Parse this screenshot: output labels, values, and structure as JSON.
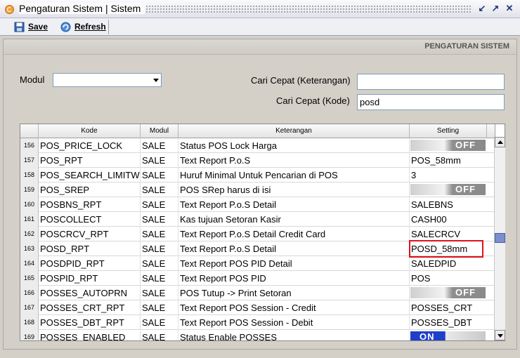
{
  "window": {
    "title": "Pengaturan Sistem | Sistem"
  },
  "toolbar": {
    "save_label": "Save",
    "refresh_label": "Refresh"
  },
  "header": {
    "title": "PENGATURAN SISTEM"
  },
  "filters": {
    "modul_label": "Modul",
    "modul_value": "",
    "cari_ket_label": "Cari Cepat (Keterangan)",
    "cari_ket_value": "",
    "cari_kode_label": "Cari Cepat (Kode)",
    "cari_kode_value": "posd"
  },
  "grid": {
    "columns": [
      "Kode",
      "Modul",
      "Keterangan",
      "Setting"
    ],
    "rows": [
      {
        "num": "156",
        "kode": "POS_PRICE_LOCK",
        "modul": "SALE",
        "ket": "Status POS Lock Harga",
        "setting": "OFF",
        "type": "toggle-off"
      },
      {
        "num": "157",
        "kode": "POS_RPT",
        "modul": "SALE",
        "ket": "Text Report P.o.S",
        "setting": "POS_58mm",
        "type": "text"
      },
      {
        "num": "158",
        "kode": "POS_SEARCH_LIMITW",
        "modul": "SALE",
        "ket": "Huruf Minimal Untuk Pencarian di POS",
        "setting": "3",
        "type": "text"
      },
      {
        "num": "159",
        "kode": "POS_SREP",
        "modul": "SALE",
        "ket": "POS SRep harus di isi",
        "setting": "OFF",
        "type": "toggle-off"
      },
      {
        "num": "160",
        "kode": "POSBNS_RPT",
        "modul": "SALE",
        "ket": "Text Report P.o.S Detail",
        "setting": "SALEBNS",
        "type": "text"
      },
      {
        "num": "161",
        "kode": "POSCOLLECT",
        "modul": "SALE",
        "ket": "Kas tujuan Setoran Kasir",
        "setting": "CASH00",
        "type": "text"
      },
      {
        "num": "162",
        "kode": "POSCRCV_RPT",
        "modul": "SALE",
        "ket": "Text Report P.o.S Detail Credit Card",
        "setting": "SALECRCV",
        "type": "text"
      },
      {
        "num": "163",
        "kode": "POSD_RPT",
        "modul": "SALE",
        "ket": "Text Report P.o.S Detail",
        "setting": "POSD_58mm",
        "type": "text"
      },
      {
        "num": "164",
        "kode": "POSDPID_RPT",
        "modul": "SALE",
        "ket": "Text Report POS PID Detail",
        "setting": "SALEDPID",
        "type": "text"
      },
      {
        "num": "165",
        "kode": "POSPID_RPT",
        "modul": "SALE",
        "ket": "Text Report POS PID",
        "setting": "POS",
        "type": "text"
      },
      {
        "num": "166",
        "kode": "POSSES_AUTOPRN",
        "modul": "SALE",
        "ket": "POS Tutup -> Print Setoran",
        "setting": "OFF",
        "type": "toggle-off"
      },
      {
        "num": "167",
        "kode": "POSSES_CRT_RPT",
        "modul": "SALE",
        "ket": "Text Report POS Session - Credit",
        "setting": "POSSES_CRT",
        "type": "text"
      },
      {
        "num": "168",
        "kode": "POSSES_DBT_RPT",
        "modul": "SALE",
        "ket": "Text Report POS Session - Debit",
        "setting": "POSSES_DBT",
        "type": "text"
      },
      {
        "num": "169",
        "kode": "POSSES_ENABLED",
        "modul": "SALE",
        "ket": "Status Enable POSSES",
        "setting": "ON",
        "type": "toggle-on"
      }
    ]
  },
  "colors": {
    "highlight": "#e0101a",
    "toggle_on": "#1f3fc9"
  }
}
